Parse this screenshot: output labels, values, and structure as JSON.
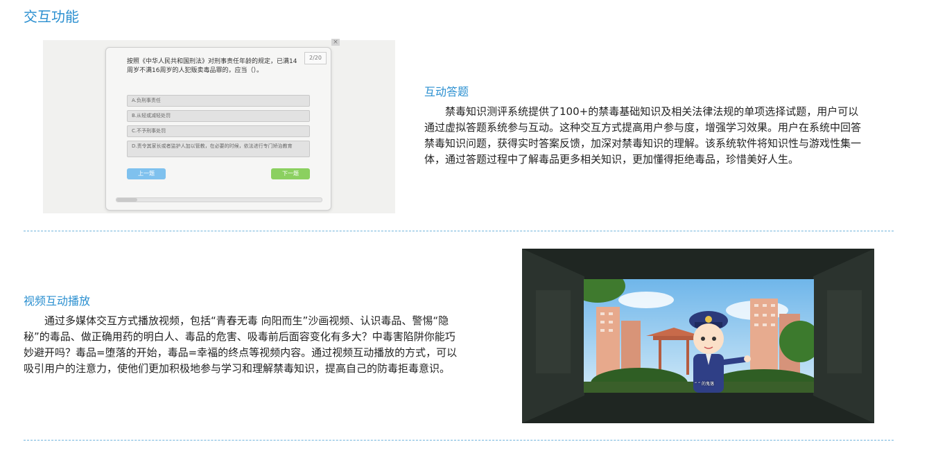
{
  "section_title": "交互功能",
  "quiz_section": {
    "heading": "互动答题",
    "paragraph": "禁毒知识测评系统提供了100+的禁毒基础知识及相关法律法规的单项选择试题，用户可以通过虚拟答题系统参与互动。这种交互方式提高用户参与度，增强学习效果。用户在系统中回答禁毒知识问题，获得实时答案反馈，加深对禁毒知识的理解。该系统软件将知识性与游戏性集一体，通过答题过程中了解毒品更多相关知识，更加懂得拒绝毒品，珍惜美好人生。",
    "screenshot": {
      "close_label": "×",
      "page_indicator": "2/20",
      "question": "按照《中华人民共和国刑法》对刑事责任年龄的规定，已满14周岁不满16周岁的人犯贩卖毒品罪的，应当（）。",
      "options": [
        "A.负刑事责任",
        "B.从轻或减轻处罚",
        "C.不予刑事处罚",
        "D.责令其家长或者监护人加以管教，在必要的时候，依法进行专门矫治教育"
      ],
      "prev_label": "上一题",
      "next_label": "下一题",
      "progress": 0.1
    }
  },
  "video_section": {
    "heading": "视频互动播放",
    "paragraph": "通过多媒体交互方式播放视频，包括“青春无毒 向阳而生”沙画视频、认识毒品、警惕“隐秘”的毒品、做正确用药的明白人、毒品的危害、吸毒前后面容变化有多大？中毒害陷阱你能巧妙避开吗？毒品=堕落的开始，毒品=幸福的终点等视频内容。通过视频互动播放的方式，可以吸引用户的注意力，使他们更加积极地参与学习和理解禁毒知识，提高自己的防毒拒毒意识。"
  },
  "colors": {
    "accent": "#2a8fd0",
    "divider": "#6fb3dc",
    "prev_button": "#7fc1ee",
    "next_button": "#8bd060"
  }
}
